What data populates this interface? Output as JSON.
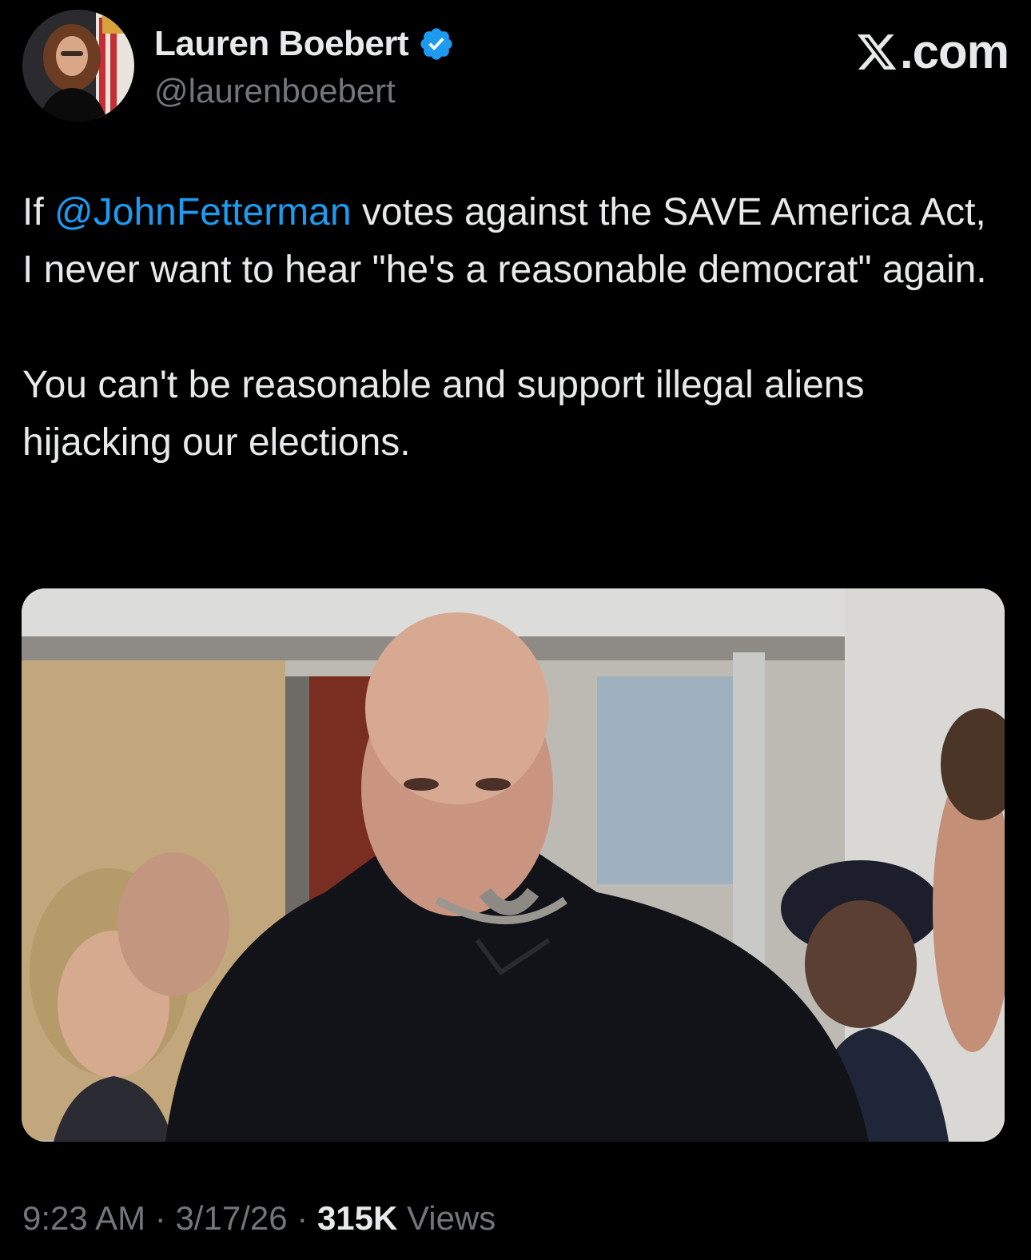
{
  "author": {
    "display_name": "Lauren Boebert",
    "handle": "@laurenboebert",
    "verified": true,
    "avatar_icon": "profile-photo"
  },
  "brand": {
    "label": ".com",
    "icon": "x-logo-icon"
  },
  "tweet": {
    "line1_prefix": "If ",
    "mention": "@JohnFetterman",
    "line1_suffix": " votes against the SAVE America Act, I never want to hear \"he's a reasonable democrat\" again.",
    "paragraph2": "You can't be reasonable and support illegal aliens hijacking our elections."
  },
  "media": {
    "type": "photo"
  },
  "meta": {
    "time": "9:23 AM",
    "separator": "·",
    "date": "3/17/26",
    "views_count": "315K",
    "views_label": "Views"
  },
  "colors": {
    "background": "#000000",
    "text": "#e7e9ea",
    "secondary": "#71767b",
    "accent": "#1d9bf0"
  }
}
